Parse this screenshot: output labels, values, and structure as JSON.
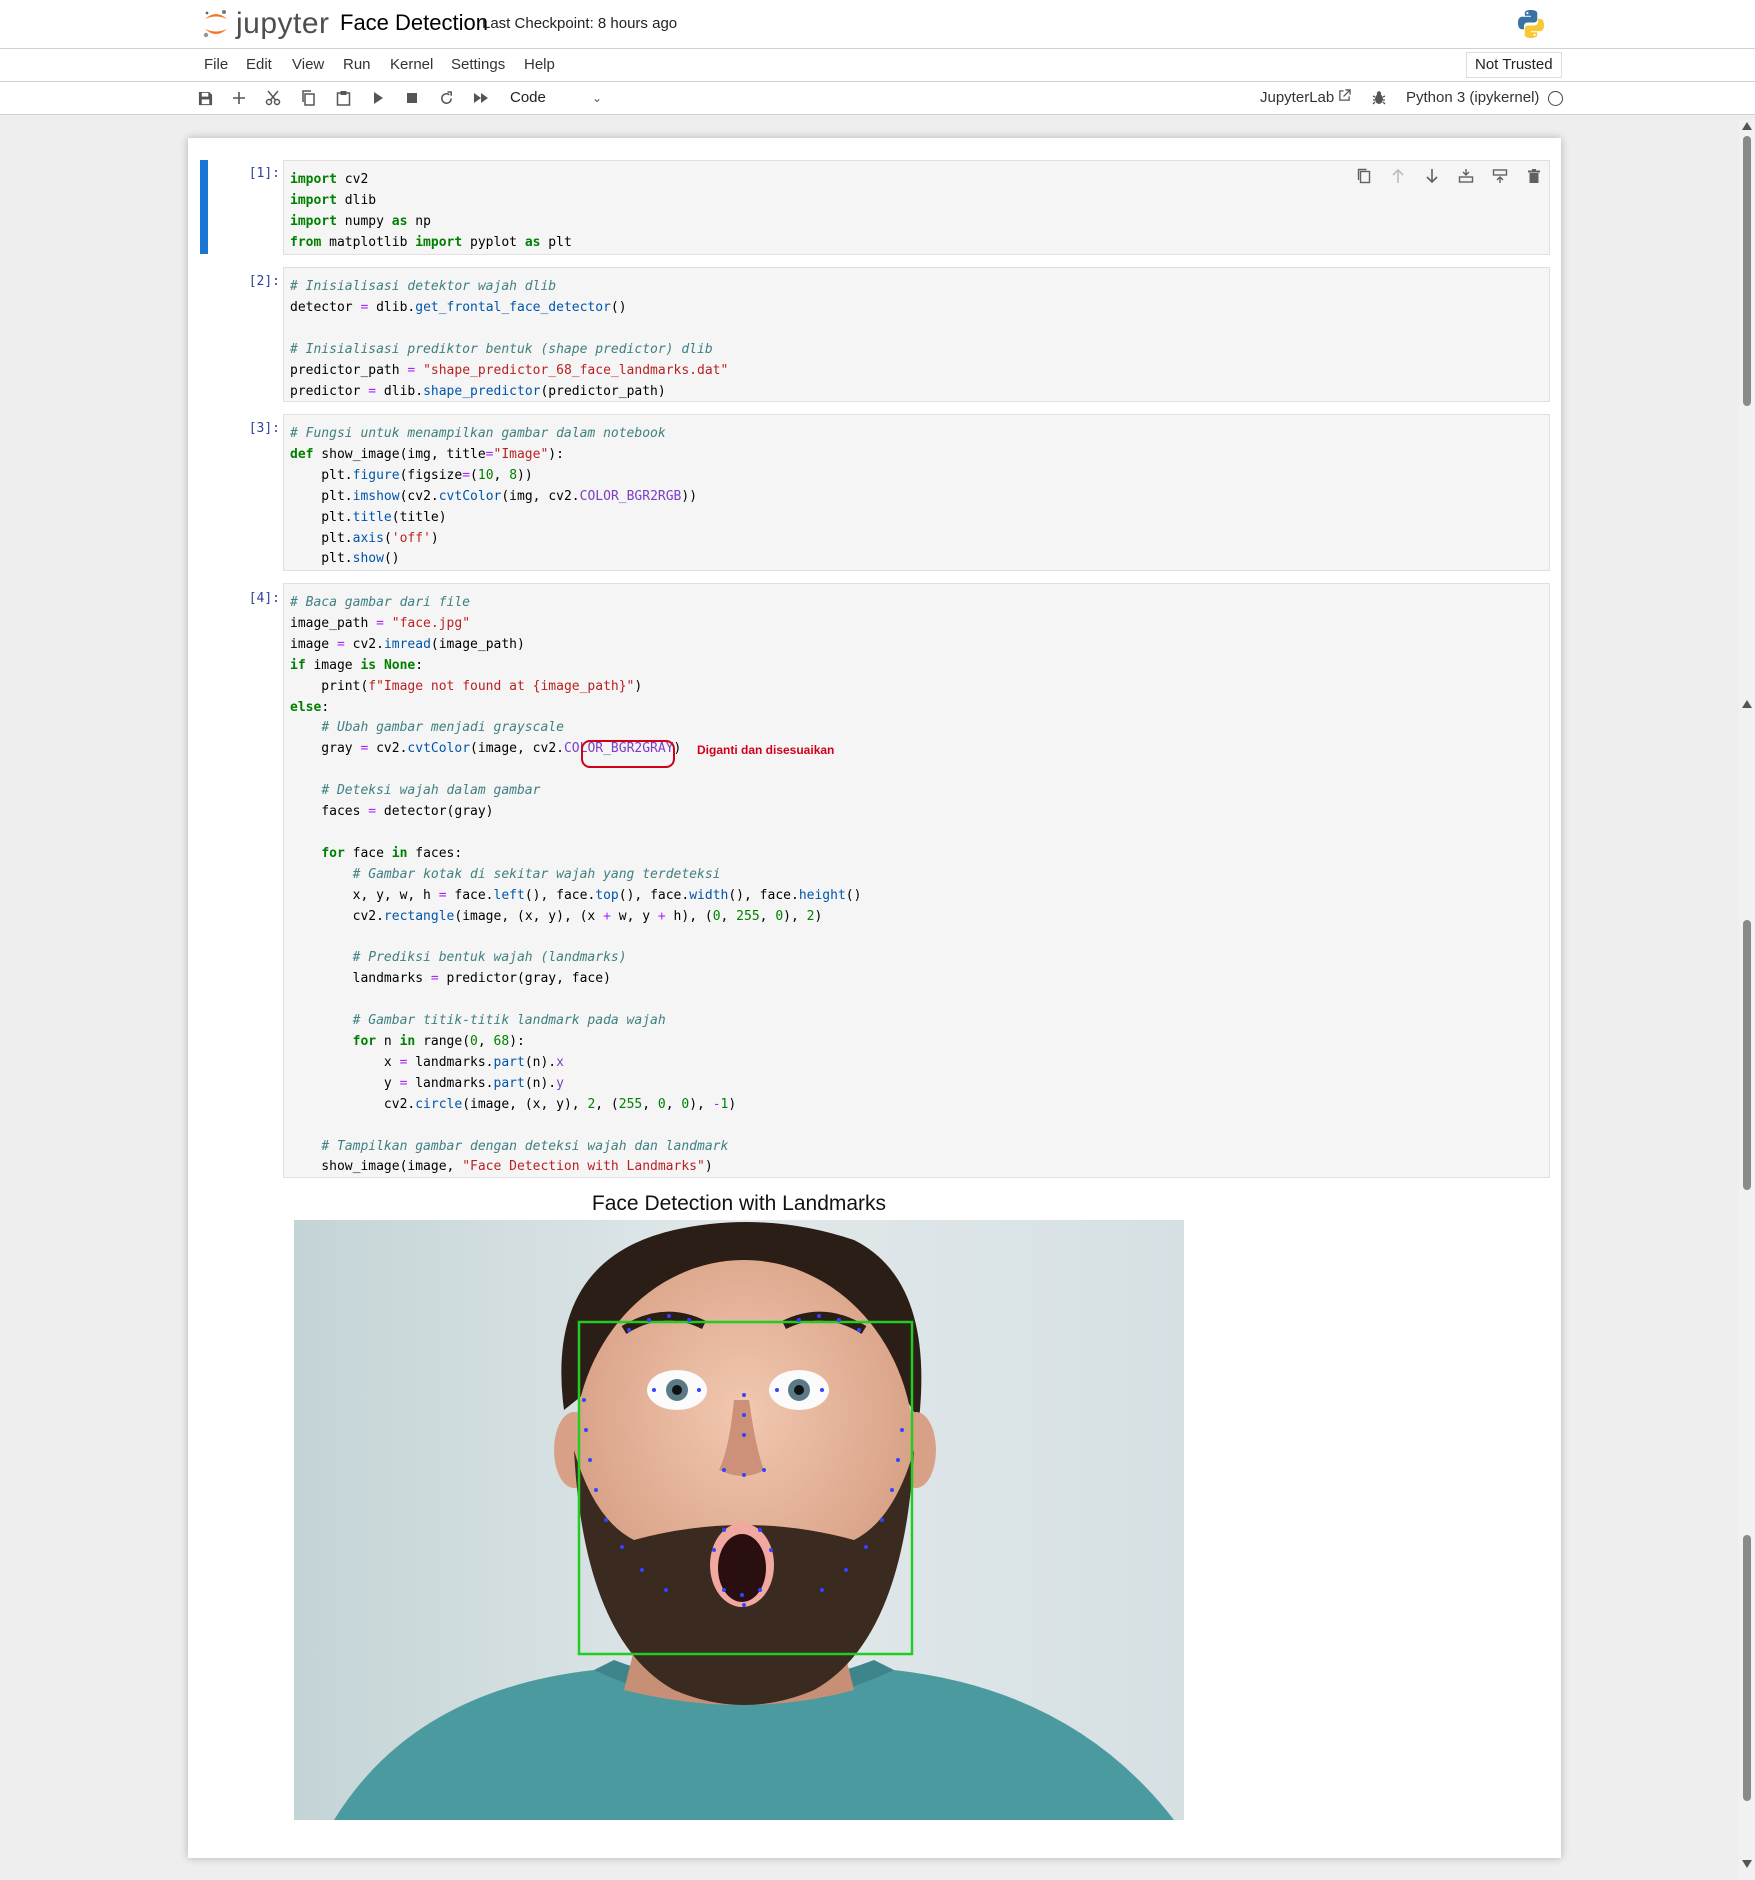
{
  "app": {
    "name": "jupyter",
    "notebook_title": "Face Detection",
    "checkpoint": "Last Checkpoint: 8 hours ago"
  },
  "menu": [
    "File",
    "Edit",
    "View",
    "Run",
    "Kernel",
    "Settings",
    "Help"
  ],
  "trust": "Not Trusted",
  "toolbar": {
    "cell_type": "Code",
    "jupyterlab_label": "JupyterLab",
    "kernel_name": "Python 3 (ipykernel)"
  },
  "cells": [
    {
      "prompt": "[1]:",
      "code": "import cv2\nimport dlib\nimport numpy as np\nfrom matplotlib import pyplot as plt"
    },
    {
      "prompt": "[2]:",
      "code": "# Inisialisasi detektor wajah dlib\ndetector = dlib.get_frontal_face_detector()\n\n# Inisialisasi prediktor bentuk (shape predictor) dlib\npredictor_path = \"shape_predictor_68_face_landmarks.dat\"\npredictor = dlib.shape_predictor(predictor_path)"
    },
    {
      "prompt": "[3]:",
      "code": "# Fungsi untuk menampilkan gambar dalam notebook\ndef show_image(img, title=\"Image\"):\n    plt.figure(figsize=(10, 8))\n    plt.imshow(cv2.cvtColor(img, cv2.COLOR_BGR2RGB))\n    plt.title(title)\n    plt.axis('off')\n    plt.show()"
    },
    {
      "prompt": "[4]:",
      "code": "# Baca gambar dari file\nimage_path = \"face.jpg\"\nimage = cv2.imread(image_path)\nif image is None:\n    print(f\"Image not found at {image_path}\")\nelse:\n    # Ubah gambar menjadi grayscale\n    gray = cv2.cvtColor(image, cv2.COLOR_BGR2GRAY)\n\n    # Deteksi wajah dalam gambar\n    faces = detector(gray)\n\n    for face in faces:\n        # Gambar kotak di sekitar wajah yang terdeteksi\n        x, y, w, h = face.left(), face.top(), face.width(), face.height()\n        cv2.rectangle(image, (x, y), (x + w, y + h), (0, 255, 0), 2)\n\n        # Prediksi bentuk wajah (landmarks)\n        landmarks = predictor(gray, face)\n\n        # Gambar titik-titik landmark pada wajah\n        for n in range(0, 68):\n            x = landmarks.part(n).x\n            y = landmarks.part(n).y\n            cv2.circle(image, (x, y), 2, (255, 0, 0), -1)\n\n    # Tampilkan gambar dengan deteksi wajah dan landmark\n    show_image(image, \"Face Detection with Landmarks\")"
    }
  ],
  "annotation": "Diganti dan disesuaikan",
  "output": {
    "plot_title": "Face Detection with Landmarks"
  },
  "colors": {
    "selected_cell": "#1976d2",
    "annotation": "#d0021b",
    "detection_box": "#22cc22",
    "landmarks": "#3344ff"
  }
}
